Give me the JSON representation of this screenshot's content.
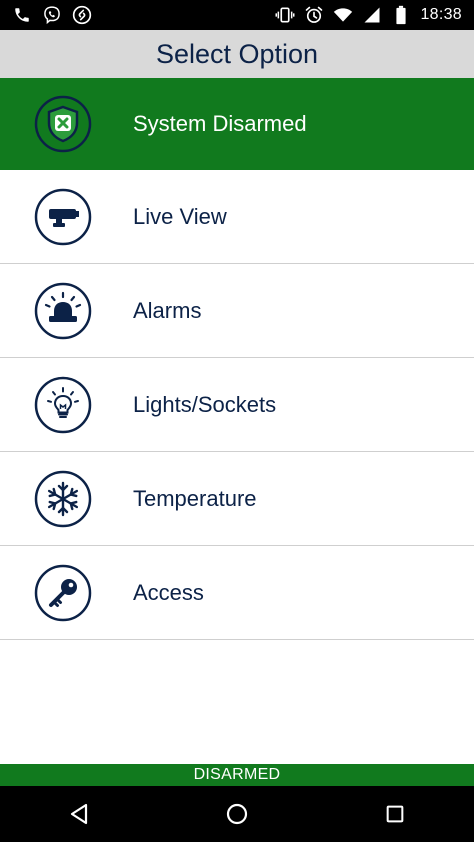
{
  "status_bar": {
    "time": "18:38",
    "left_icons": [
      "phone-icon",
      "viber-icon",
      "shazam-icon"
    ],
    "right_icons": [
      "vibrate-icon",
      "alarm-icon",
      "wifi-icon",
      "signal-icon",
      "battery-icon"
    ]
  },
  "header": {
    "title": "Select Option"
  },
  "menu": {
    "items": [
      {
        "label": "System Disarmed",
        "icon": "shield-x-icon",
        "active": true
      },
      {
        "label": "Live View",
        "icon": "camera-icon"
      },
      {
        "label": "Alarms",
        "icon": "siren-icon"
      },
      {
        "label": "Lights/Sockets",
        "icon": "lightbulb-icon"
      },
      {
        "label": "Temperature",
        "icon": "snowflake-icon"
      },
      {
        "label": "Access",
        "icon": "key-icon"
      }
    ]
  },
  "footer": {
    "status": "DISARMED"
  },
  "colors": {
    "green": "#117a1e",
    "navy": "#0c2247",
    "header_bg": "#d9d9d9"
  },
  "nav": {
    "buttons": [
      "back-icon",
      "home-icon",
      "recents-icon"
    ]
  }
}
